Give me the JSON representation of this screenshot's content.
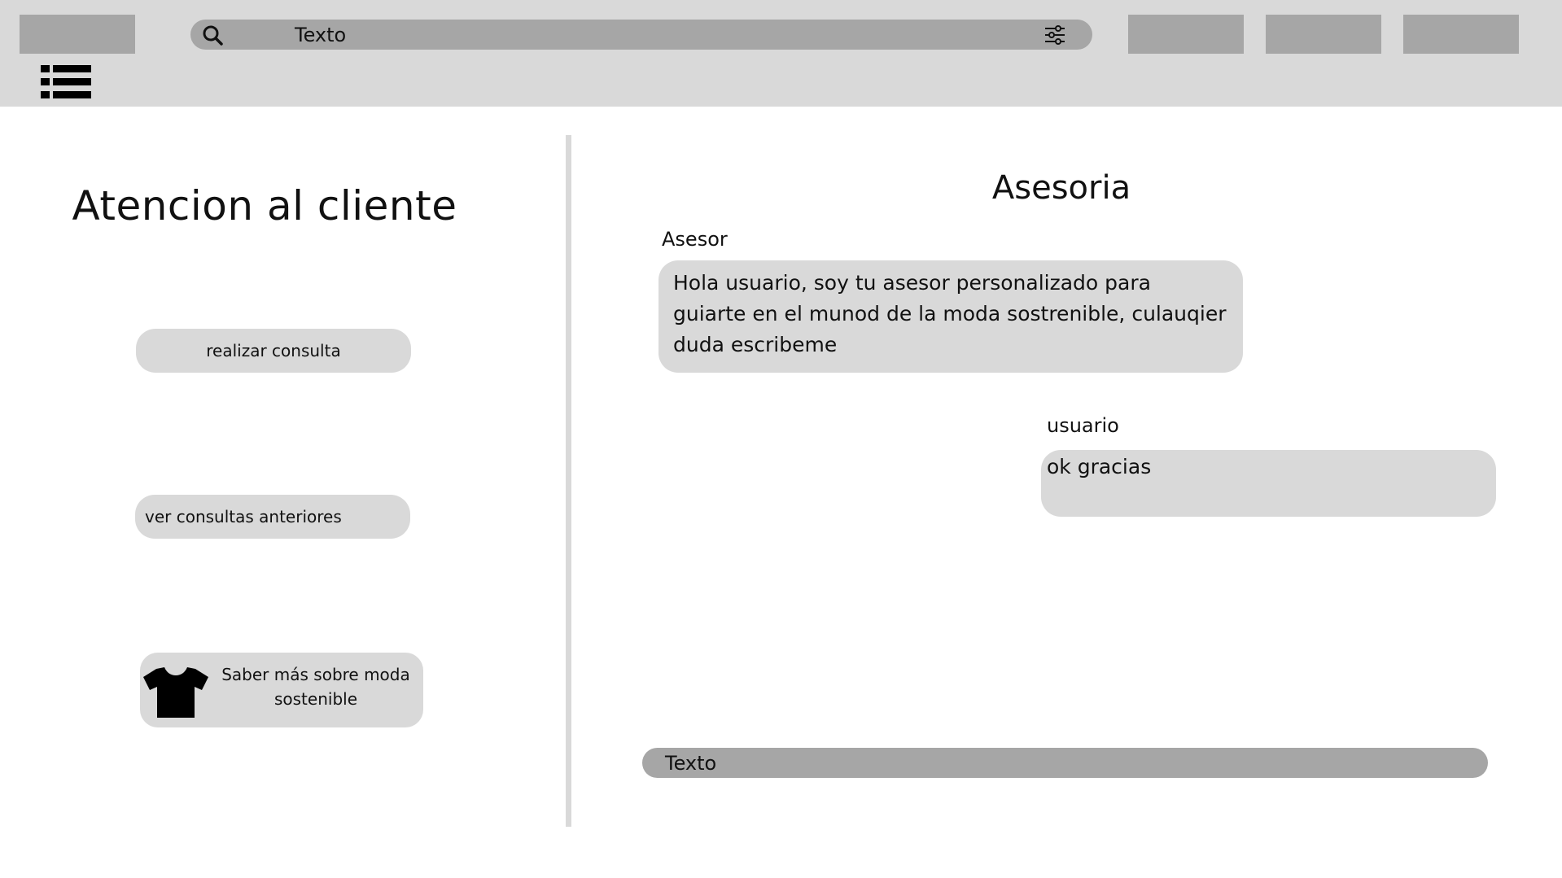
{
  "header": {
    "search": {
      "text": "Texto",
      "icon": "search-icon",
      "filter_icon": "sliders-icon"
    },
    "menu_icon": "list-menu-icon"
  },
  "left_panel": {
    "title": "Atencion al cliente",
    "buttons": [
      {
        "label": "realizar consulta"
      },
      {
        "label": "ver consultas anteriores"
      },
      {
        "label": "Saber más sobre moda sostenible",
        "icon": "t-shirt-icon"
      }
    ]
  },
  "chat": {
    "title": "Asesoria",
    "messages": [
      {
        "sender": "Asesor",
        "text": "Hola usuario, soy tu asesor personalizado para guiarte en el munod de la moda sostrenible, culauqier duda escribeme"
      },
      {
        "sender": "usuario",
        "text": "ok gracias"
      }
    ],
    "input": {
      "text": "Texto"
    }
  },
  "colors": {
    "header_bg": "#d9d9d9",
    "control_bg": "#a6a6a6",
    "bubble_bg": "#d9d9d9",
    "text": "#111111"
  }
}
